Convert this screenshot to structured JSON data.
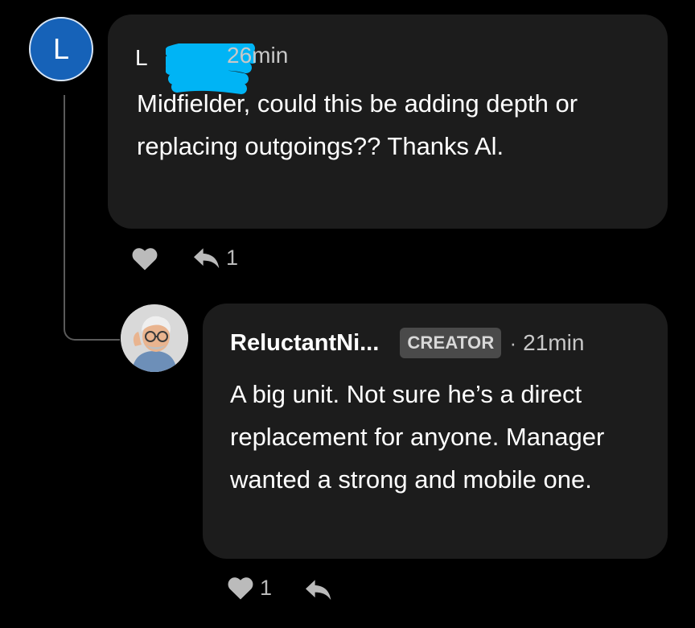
{
  "comment1": {
    "avatar_letter": "L",
    "author_initial": "L",
    "time": "26min",
    "body": "Midfielder, could this be adding depth or replacing outgoings?? Thanks Al.",
    "reply_count": "1"
  },
  "comment2": {
    "author": "ReluctantNi...",
    "badge": "CREATOR",
    "separator": "·",
    "time": "21min",
    "body": "A big unit. Not sure he’s a direct replacement for anyone. Manager wanted a strong and mobile one.",
    "like_count": "1"
  },
  "icons": {
    "like": "heart-icon",
    "reply": "reply-arrow-icon",
    "redaction": "scribble-redaction"
  },
  "colors": {
    "background": "#000000",
    "bubble": "#1c1c1c",
    "avatar_blue": "#1662b8",
    "redaction_cyan": "#00b4f5",
    "badge_bg": "#4a4a4a"
  }
}
